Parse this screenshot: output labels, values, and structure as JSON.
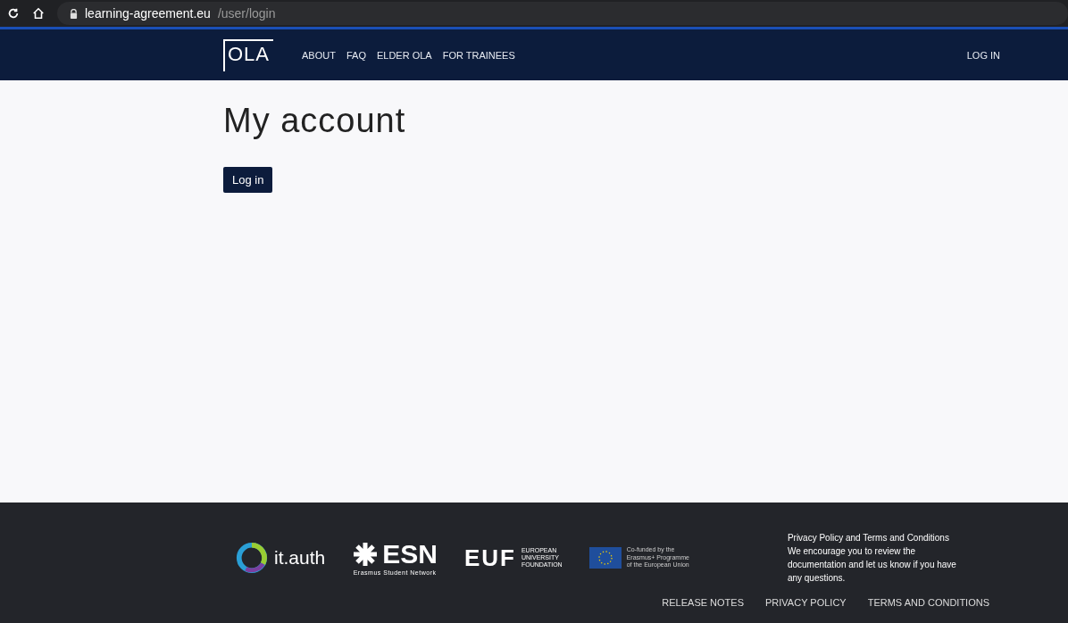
{
  "browser": {
    "url_host": "learning-agreement.eu",
    "url_path": "/user/login"
  },
  "nav": {
    "logo": "OLA",
    "items": [
      "ABOUT",
      "FAQ",
      "ELDER OLA",
      "FOR TRAINEES"
    ],
    "login": "LOG IN"
  },
  "page": {
    "title": "My account",
    "button": "Log in"
  },
  "footer": {
    "partners": [
      {
        "kind": "itauth",
        "name": "it.auth"
      },
      {
        "kind": "esn",
        "name": "ESN",
        "sub": "Erasmus Student Network"
      },
      {
        "kind": "euf",
        "name": "EUF",
        "lines": [
          "EUROPEAN",
          "UNIVERSITY",
          "FOUNDATION"
        ]
      },
      {
        "kind": "eu",
        "lines": [
          "Co-funded by the",
          "Erasmus+ Programme",
          "of the European Union"
        ]
      }
    ],
    "notice_title": "Privacy Policy and Terms and Conditions",
    "notice": "We encourage you to review the documentation and let us know if you have any questions.",
    "links": [
      "RELEASE NOTES",
      "PRIVACY POLICY",
      "TERMS AND CONDITIONS"
    ]
  }
}
